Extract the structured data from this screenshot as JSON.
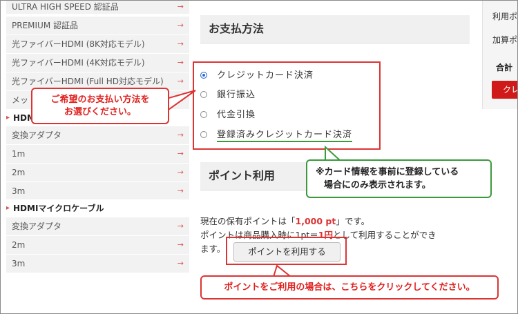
{
  "sidebar": {
    "group1": [
      "ULTRA HIGH SPEED 認証品",
      "PREMIUM 認証品",
      "光ファイバーHDMI (8K対応モデル)",
      "光ファイバーHDMI (4K対応モデル)",
      "光ファイバーHDMI (Full HD対応モデル)",
      "メッ"
    ],
    "head_truncated": "HDMI",
    "group2": [
      "変換アダプタ",
      "1m",
      "2m",
      "3m"
    ],
    "head2": "HDMIマイクロケーブル",
    "group3": [
      "変換アダプタ",
      "2m",
      "3m"
    ],
    "arrow": "→"
  },
  "payment": {
    "title": "お支払方法",
    "options": [
      "クレジットカード決済",
      "銀行振込",
      "代金引換",
      "登録済みクレジットカード決済"
    ],
    "selected_index": 0
  },
  "points": {
    "title": "ポイント利用",
    "line1_pre": "現在の保有ポイントは「",
    "line1_value": "1,000 pt",
    "line1_post": "」です。",
    "line2_pre": "ポイントは商品購入時に1pt＝",
    "line2_value": "1円",
    "line2_post": "として利用することができ",
    "line3": "ます。",
    "button_label": "ポイントを利用する"
  },
  "callouts": {
    "payment_hint_line1": "ご希望のお支払い方法を",
    "payment_hint_line2": "お選びください。",
    "registered_note_line1": "※カード情報を事前に登録している",
    "registered_note_line2": "場合にのみ表示されます。",
    "points_hint": "ポイントをご利用の場合は、こちらをクリックしてください。"
  },
  "right_panel": {
    "line1": "利用ポ",
    "line2": "加算ポ",
    "total": "合計",
    "button": "クレ"
  },
  "colors": {
    "accent_red": "#d33333",
    "note_green": "#3a9a3a",
    "radio_blue": "#2a6fd1"
  }
}
